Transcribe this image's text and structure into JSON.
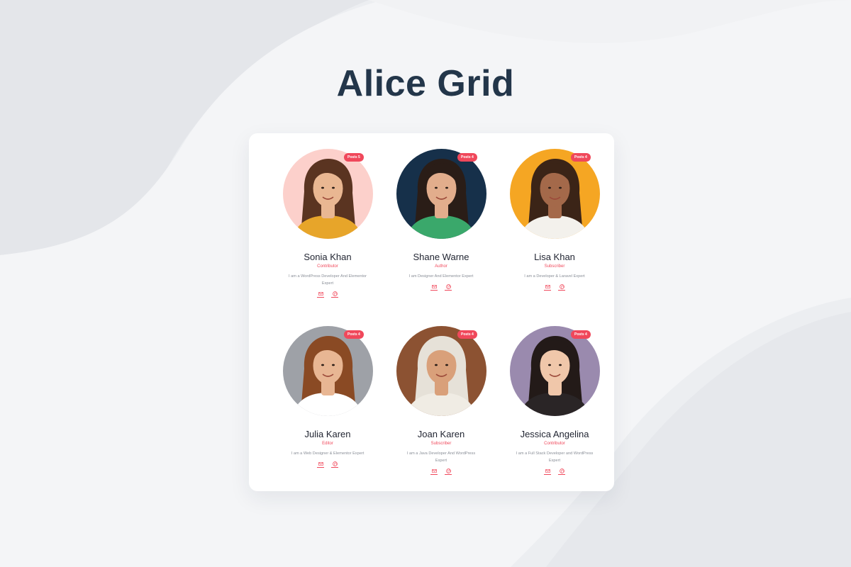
{
  "page": {
    "title": "Alice Grid",
    "title_color": "#23364a",
    "accent": "#f0485b"
  },
  "members": [
    {
      "name": "Sonia Khan",
      "role": "Contributor",
      "posts": "Posts 5",
      "bio": "I am a WordPress Developer And Elementor Expert",
      "avatar_bg": "#fcd0cb",
      "skin": "#e9b792",
      "hair": "#5a3421",
      "shirt": "#e7a52a"
    },
    {
      "name": "Shane Warne",
      "role": "Author",
      "posts": "Posts 4",
      "bio": "I am Designer And Elementor Expert",
      "avatar_bg": "#16304a",
      "skin": "#e2ad8c",
      "hair": "#2a1d17",
      "shirt": "#3aa86b"
    },
    {
      "name": "Lisa Khan",
      "role": "Subscriber",
      "posts": "Posts 4",
      "bio": "I am a Developer & Laravel Expert",
      "avatar_bg": "#f5a623",
      "skin": "#a4694a",
      "hair": "#3b2417",
      "shirt": "#f3f1ec"
    },
    {
      "name": "Julia Karen",
      "role": "Editor",
      "posts": "Posts 4",
      "bio": "I am a Web Designer & Elementor Expert",
      "avatar_bg": "#9ea1a7",
      "skin": "#e8b693",
      "hair": "#8a4a24",
      "shirt": "#ffffff"
    },
    {
      "name": "Joan Karen",
      "role": "Subscriber",
      "posts": "Posts 4",
      "bio": "I am a Java Developer And WordPress Expert",
      "avatar_bg": "#8c5232",
      "skin": "#d9a07a",
      "hair": "#e6e1d8",
      "shirt": "#f0ece4"
    },
    {
      "name": "Jessica Angelina",
      "role": "Contributor",
      "posts": "Posts 4",
      "bio": "I am a Full Stack Developer and WordPress Expert",
      "avatar_bg": "#9a8aae",
      "skin": "#f0c7aa",
      "hair": "#231a18",
      "shirt": "#2a2526"
    }
  ],
  "icons": {
    "email": "envelope-icon",
    "website": "globe-icon"
  }
}
